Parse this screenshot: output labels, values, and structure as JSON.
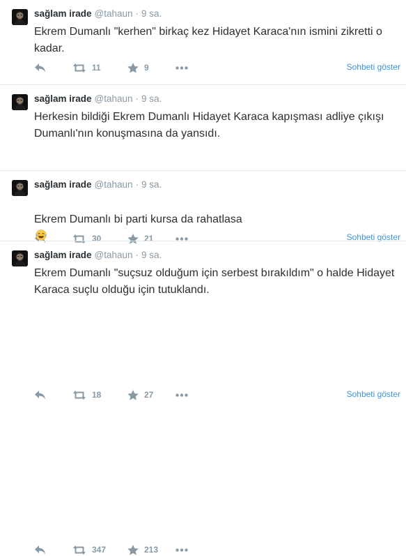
{
  "tweets": [
    {
      "fullname": "sağlam irade",
      "username": "@tahaun",
      "separator": "·",
      "time": "9 sa.",
      "text": "Ekrem Dumanlı \"kerhen\" birkaç kez Hidayet Karaca'nın ismini zikretti o kadar.",
      "retweets": "11",
      "favorites": "9",
      "conversation": "Sohbeti göster"
    },
    {
      "fullname": "sağlam irade",
      "username": "@tahaun",
      "separator": "·",
      "time": "9 sa.",
      "text": "Herkesin bildiği Ekrem Dumanlı Hidayet Karaca kapışması adliye çıkışı Dumanlı'nın konuşmasına da yansıdı.",
      "retweets": "30",
      "favorites": "21",
      "conversation": "Sohbeti göster"
    },
    {
      "fullname": "sağlam irade",
      "username": "@tahaun",
      "separator": "·",
      "time": "9 sa.",
      "text": "Ekrem Dumanlı bi parti kursa da rahatlasa",
      "retweets": "18",
      "favorites": "27",
      "conversation": "Sohbeti göster"
    },
    {
      "fullname": "sağlam irade",
      "username": "@tahaun",
      "separator": "·",
      "time": "9 sa.",
      "text": "Ekrem Dumanlı \"suçsuz olduğum için serbest bırakıldım\" o halde Hidayet Karaca suçlu olduğu için tutuklandı.",
      "retweets": "347",
      "favorites": "213"
    }
  ],
  "icons": {
    "reply": "reply-icon",
    "retweet": "retweet-icon",
    "favorite": "star-icon",
    "more": "more-icon",
    "emoji": "tears-of-joy-emoji"
  },
  "colors": {
    "text": "#292f33",
    "muted": "#8899a6",
    "link": "#3b94d9",
    "divider": "#e1e8ed"
  }
}
